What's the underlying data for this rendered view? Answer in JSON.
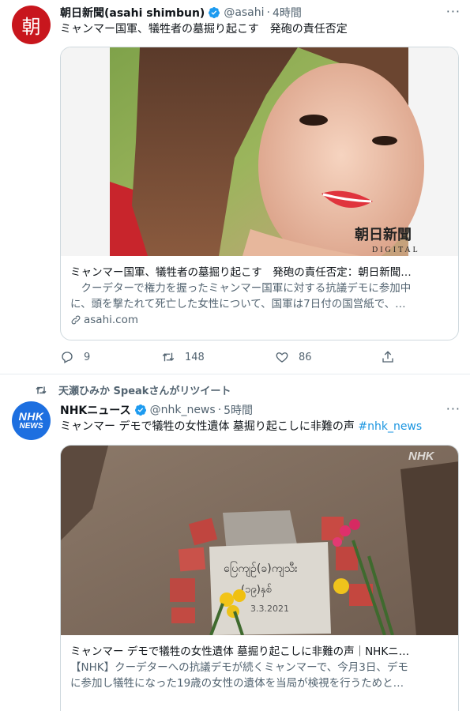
{
  "tweets": [
    {
      "author": {
        "name": "朝日新聞(asahi shimbun)",
        "handle": "@asahi",
        "time": "4時間",
        "avatar_glyph": "朝",
        "avatar_color": "#c8161d"
      },
      "text": "ミャンマー国軍、犠牲者の墓掘り起こす　発砲の責任否定",
      "card": {
        "image_watermark_line1": "朝日新聞",
        "image_watermark_line2": "DIGITAL",
        "title": "ミャンマー国軍、犠牲者の墓掘り起こす　発砲の責任否定：朝日新聞…",
        "desc_line1": "　クーデターで権力を握ったミャンマー国軍に対する抗議デモに参加中",
        "desc_line2": "に、頭を撃たれて死亡した女性について、国軍は7日付の国営紙で、…",
        "domain": "asahi.com",
        "domain_icon": "link-icon"
      },
      "stats": {
        "replies": "9",
        "retweets": "148",
        "likes": "86"
      }
    },
    {
      "retweeted_by": "天瀬ひみか Speakさんがリツイート",
      "author": {
        "name": "NHKニュース",
        "handle": "@nhk_news",
        "time": "5時間",
        "avatar_line1": "NHK",
        "avatar_line2": "NEWS",
        "avatar_color": "#1d6fe0"
      },
      "text": "ミャンマー デモで犠牲の女性遺体 墓掘り起こしに非難の声",
      "hashtag": "#nhk_news",
      "card": {
        "image_watermark": "NHK",
        "stone_text_line1": "ပြေကျဉ်(ခ)ကျသီး",
        "stone_text_line2": "(၁၉)နှစ်",
        "stone_date": "3.3.2021",
        "title": "ミャンマー デモで犠牲の女性遺体 墓掘り起こしに非難の声｜NHKニ…",
        "desc_line1": "【NHK】クーデターへの抗議デモが続くミャンマーで、今月3日、デモ",
        "desc_line2": "に参加し犠牲になった19歳の女性の遺体を当局が検視を行うためと…"
      }
    }
  ],
  "colors": {
    "link": "#1b95e0",
    "secondary_text": "#536471",
    "border": "#cfd9de"
  },
  "sep": "·",
  "more": "···"
}
